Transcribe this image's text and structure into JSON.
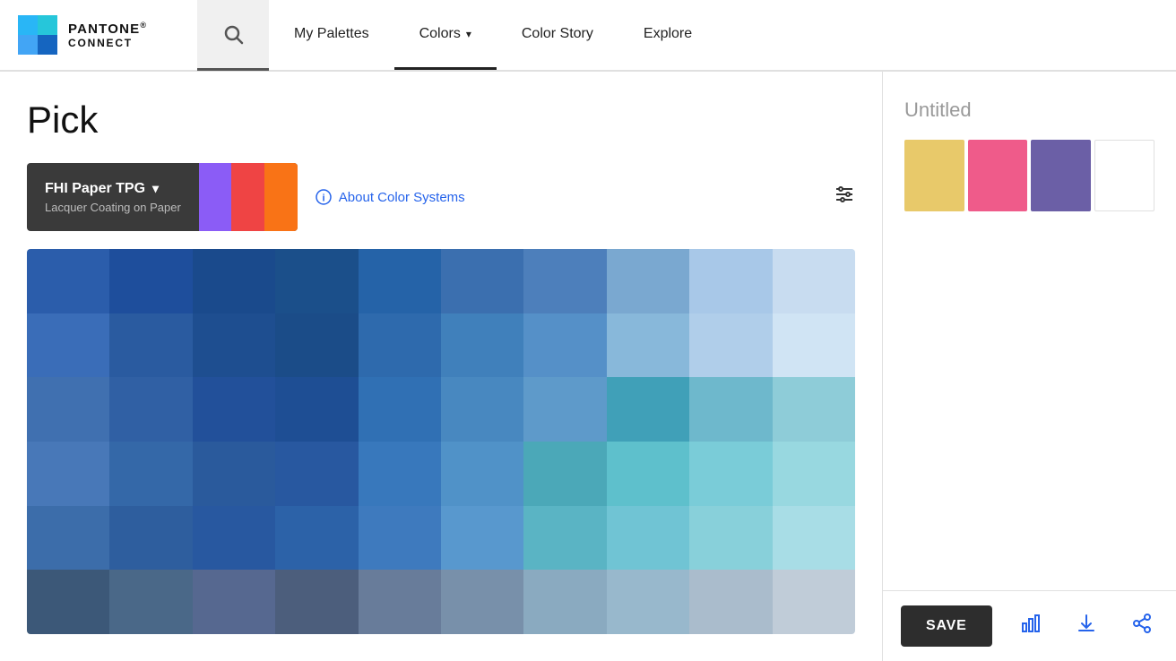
{
  "app": {
    "name": "PANTONE",
    "sub": "CONNECT"
  },
  "nav": {
    "items": [
      {
        "label": "My Palettes",
        "active": false
      },
      {
        "label": "Colors",
        "active": true,
        "hasChevron": true
      },
      {
        "label": "Color Story",
        "active": false
      },
      {
        "label": "Explore",
        "active": false
      }
    ]
  },
  "page": {
    "title": "Pick"
  },
  "colorSystem": {
    "name": "FHI Paper TPG",
    "subtitle": "Lacquer Coating on Paper",
    "aboutLabel": "About Color Systems"
  },
  "palette": {
    "title": "Untitled",
    "swatches": [
      {
        "color": "#E8C96A",
        "label": "Yellow swatch"
      },
      {
        "color": "#EF5B8A",
        "label": "Pink swatch"
      },
      {
        "color": "#6B5FA6",
        "label": "Purple swatch"
      }
    ],
    "saveLabel": "SAVE"
  },
  "colorGrid": {
    "colors": [
      "#2B5DAB",
      "#1E4E9C",
      "#1A4A8C",
      "#1B4F8A",
      "#2563A8",
      "#3B6FAF",
      "#4D7FBB",
      "#7AA8D0",
      "#A8C8E8",
      "#C8DCF0",
      "#3A6DB8",
      "#2A5BA0",
      "#1E4E90",
      "#1B4C88",
      "#2E6AAD",
      "#4080BB",
      "#5590C8",
      "#88B8DA",
      "#B0CEEA",
      "#D0E4F4",
      "#4070B0",
      "#3060A4",
      "#22509A",
      "#1E4E94",
      "#3070B4",
      "#4888C0",
      "#5E9ACA",
      "#40A0B8",
      "#6EB8CC",
      "#8ECCD8",
      "#4878B8",
      "#3468A8",
      "#2A5A9C",
      "#2858A0",
      "#3878BC",
      "#5092C8",
      "#4BA8B8",
      "#5EC0CC",
      "#7ACCD8",
      "#98D8E0",
      "#3C6DAA",
      "#2E5E9E",
      "#2858A0",
      "#2C62A8",
      "#3E7ABE",
      "#5898CE",
      "#5AB4C4",
      "#70C4D4",
      "#88D0DA",
      "#A8DDE6",
      "#3C5878",
      "#4A6888",
      "#566890",
      "#4C5E7C",
      "#687C9A",
      "#7890AA",
      "#8AAAC0",
      "#98B8CC",
      "#AABCCC",
      "#C0CCD8"
    ]
  }
}
